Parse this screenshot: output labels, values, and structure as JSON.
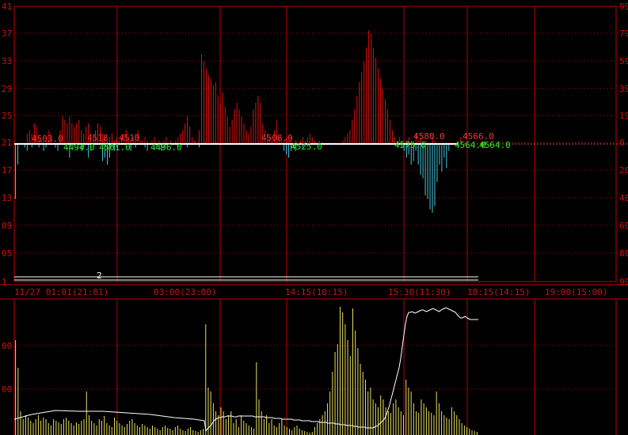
{
  "colors": {
    "background": "#000000",
    "grid": "#c00000",
    "axis_text": "#d01010",
    "time_text": "#c81414",
    "up_bar": "#e01010",
    "down_bar": "#40c8e0",
    "price_line": "#ffffff",
    "dotted_ref": "#ff4040",
    "green_label": "#22ee22",
    "red_label": "#ff3030",
    "volume_bar": "#e8e060",
    "volume_line": "#ffffff"
  },
  "upper_axis": {
    "left_ticks": [
      "41",
      "37",
      "33",
      "29",
      "25",
      "21",
      "17",
      "13",
      "09",
      "05",
      "1"
    ],
    "right_ticks": [
      "99",
      "79",
      "59",
      "39",
      "19",
      "0",
      "20",
      "40",
      "60",
      "80",
      "99"
    ]
  },
  "lower_axis": {
    "left_ticks": [
      "00",
      "00"
    ],
    "right_ticks": [
      "",
      ""
    ]
  },
  "time_axis": [
    "11/27 01:01(21:01)",
    "03:00(23:00)",
    "14:15(10:15)",
    "15:30(11:30)",
    "18:15(14:15)",
    "19:00(15:00)"
  ],
  "marker": "2",
  "price_labels": [
    {
      "text": "4494.0",
      "color": "green"
    },
    {
      "text": "4501.0",
      "color": "green"
    },
    {
      "text": "4496.0",
      "color": "green"
    },
    {
      "text": "4525.0",
      "color": "green"
    },
    {
      "text": "4575.0",
      "color": "green"
    },
    {
      "text": "4564.0",
      "color": "green"
    },
    {
      "text": "4564.0",
      "color": "green"
    },
    {
      "text": "4503.0",
      "color": "red"
    },
    {
      "text": "4510",
      "color": "red"
    },
    {
      "text": "4518",
      "color": "red"
    },
    {
      "text": "4508.0",
      "color": "red"
    },
    {
      "text": "4580.0",
      "color": "red"
    },
    {
      "text": "4566.0",
      "color": "red"
    }
  ],
  "chart_data": [
    {
      "type": "bar",
      "title": "",
      "ylim": [
        1,
        41
      ],
      "baseline": 21,
      "upper_values": [
        0,
        0,
        0,
        0,
        0,
        1.5,
        2,
        1.5,
        3,
        2.5,
        1,
        0.5,
        0,
        1,
        2,
        1.5,
        0,
        0,
        0,
        2,
        4,
        3.5,
        3,
        4,
        3,
        2.5,
        3,
        3.5,
        2,
        1.5,
        2.5,
        3,
        1.5,
        1,
        2,
        3,
        2.5,
        1.5,
        1,
        0.5,
        1,
        1.5,
        0.5,
        1,
        0.5,
        1,
        1.5,
        2,
        1,
        0.5,
        1,
        1.5,
        2,
        0.5,
        0.5,
        1,
        0.5,
        0,
        0.5,
        1,
        0,
        0.5,
        0,
        0.5,
        1,
        0,
        0.5,
        0,
        0.5,
        1,
        1.5,
        2,
        3,
        4,
        2.5,
        1,
        0.5,
        0,
        2,
        13,
        12,
        11,
        10,
        9.5,
        8.5,
        9,
        7,
        6,
        7.5,
        5.5,
        4,
        2.5,
        3.5,
        5,
        6,
        5,
        4,
        3,
        2,
        1.5,
        2.5,
        5,
        6,
        7,
        6,
        3,
        2,
        1.5,
        1,
        0.5,
        2,
        3.5,
        1,
        0.5,
        0.5,
        1,
        0.5,
        1,
        0,
        0.5,
        0,
        0.5,
        1,
        0.5,
        1,
        1.5,
        1,
        0.5,
        0,
        0.5,
        0,
        0,
        0,
        0,
        0,
        0,
        0,
        0,
        0,
        0.5,
        1,
        1.5,
        2,
        3.5,
        5,
        7,
        9,
        10.5,
        12,
        14,
        16.5,
        16,
        14,
        12.5,
        11,
        9.5,
        8,
        6.5,
        5,
        3.5,
        2,
        1,
        0.5,
        1,
        0.5,
        0,
        0.5,
        1,
        0,
        0,
        1.5,
        0.5,
        1,
        0,
        0.5,
        0,
        0,
        1,
        0.5,
        0,
        0,
        0,
        0,
        0,
        0,
        0,
        0,
        0,
        0,
        1,
        0,
        0,
        0,
        0,
        0,
        0,
        0
      ],
      "lower_values": [
        8,
        3,
        0,
        0,
        0.5,
        1,
        0,
        0.5,
        0,
        0,
        0.5,
        0,
        1,
        0.5,
        0,
        0,
        0,
        0.5,
        1,
        0,
        0,
        0,
        0,
        2,
        0,
        0,
        0,
        0,
        1,
        0.5,
        0,
        2,
        1,
        0,
        0,
        0,
        0,
        2.5,
        2,
        3,
        2,
        0.5,
        1,
        0.5,
        0,
        0,
        0,
        0,
        0,
        1,
        0,
        0.5,
        0,
        0,
        0,
        0.5,
        1,
        0,
        0,
        0,
        0.5,
        0,
        1,
        0.5,
        0,
        0,
        0,
        0,
        0,
        0.5,
        0,
        0,
        0,
        0.5,
        0,
        0,
        0,
        0,
        0.5,
        0,
        0,
        0,
        0,
        0,
        0,
        0,
        0,
        0,
        0,
        0,
        0,
        0,
        0,
        0,
        0,
        0,
        0,
        0,
        0,
        0,
        0,
        0,
        0,
        0,
        0,
        0,
        0,
        0,
        0,
        0,
        0,
        0,
        0,
        0,
        1,
        1.5,
        2,
        1,
        0.5,
        1,
        0,
        0,
        0.5,
        0,
        0,
        0,
        0,
        0,
        0,
        0,
        0,
        0,
        0,
        0,
        0,
        0,
        0,
        0,
        0,
        0,
        0,
        0,
        0,
        0,
        0,
        0,
        0,
        0,
        0,
        0,
        0,
        0,
        0,
        0,
        0,
        0,
        0,
        0,
        0,
        0,
        0,
        0,
        0,
        0,
        0.5,
        1,
        2,
        1.5,
        3,
        2.5,
        1,
        3,
        4.5,
        5,
        7.5,
        8,
        9.5,
        10,
        9,
        5.5,
        3,
        4,
        2,
        3.5,
        1,
        0,
        0,
        0,
        0,
        0,
        0,
        0,
        0,
        0,
        0,
        0,
        0,
        0,
        0
      ]
    },
    {
      "type": "bar",
      "title": "",
      "volume_values": [
        120,
        85,
        30,
        20,
        25,
        22,
        18,
        15,
        20,
        25,
        18,
        22,
        20,
        15,
        12,
        20,
        18,
        16,
        14,
        20,
        22,
        18,
        15,
        12,
        16,
        14,
        18,
        20,
        55,
        25,
        18,
        15,
        12,
        20,
        18,
        24,
        15,
        12,
        10,
        22,
        18,
        15,
        12,
        10,
        14,
        18,
        20,
        15,
        12,
        10,
        14,
        12,
        10,
        8,
        12,
        10,
        8,
        6,
        10,
        12,
        9,
        8,
        6,
        10,
        12,
        8,
        6,
        5,
        8,
        10,
        6,
        5,
        4,
        6,
        8,
        140,
        60,
        55,
        40,
        30,
        25,
        35,
        30,
        20,
        25,
        30,
        15,
        20,
        10,
        25,
        18,
        15,
        12,
        10,
        8,
        92,
        45,
        30,
        20,
        25,
        15,
        20,
        12,
        10,
        15,
        20,
        12,
        10,
        8,
        6,
        10,
        12,
        8,
        6,
        5,
        4,
        3,
        4,
        10,
        15,
        20,
        25,
        30,
        40,
        55,
        80,
        105,
        115,
        162,
        155,
        140,
        120,
        100,
        160,
        132,
        110,
        90,
        80,
        70,
        55,
        60,
        45,
        40,
        35,
        50,
        45,
        35,
        30,
        28,
        40,
        45,
        35,
        30,
        25,
        70,
        60,
        55,
        40,
        30,
        28,
        45,
        40,
        35,
        30,
        28,
        25,
        55,
        40,
        30,
        25,
        22,
        20,
        35,
        30,
        25,
        20,
        15,
        12,
        10,
        8,
        6,
        5,
        4
      ],
      "volume_line": [
        0,
        5,
        8,
        10,
        12,
        15,
        18,
        20,
        21,
        22,
        22,
        23,
        23,
        23,
        24,
        24,
        24,
        24,
        23,
        23,
        23,
        24,
        24,
        24,
        24,
        24,
        24,
        24,
        24,
        24,
        24,
        23,
        23,
        23,
        23,
        23,
        23,
        23,
        22,
        22,
        22,
        22,
        22,
        21,
        21,
        21,
        21,
        21,
        20,
        20,
        20,
        20,
        20,
        20,
        20,
        19,
        19,
        19,
        19,
        19,
        18,
        18,
        18,
        18,
        18,
        18,
        17,
        17,
        17,
        17,
        17,
        16,
        16,
        16,
        16,
        16,
        15,
        15,
        15,
        15,
        15,
        14,
        14,
        14,
        13,
        13,
        13,
        13,
        12,
        12,
        12,
        12,
        11,
        11,
        11,
        10,
        10,
        10,
        10,
        10,
        9,
        9,
        9,
        9,
        9,
        10,
        11,
        12,
        14,
        16,
        18,
        20,
        24,
        30,
        36,
        44,
        52,
        60,
        68,
        76,
        84,
        95,
        110,
        125,
        140,
        150,
        155,
        155,
        156,
        155,
        154,
        155,
        156,
        157,
        158,
        158,
        157,
        156,
        157,
        158,
        159,
        160,
        159,
        158,
        157,
        156,
        158,
        159,
        160,
        161,
        160,
        159,
        158,
        157,
        156,
        155,
        152,
        150,
        148,
        148,
        149,
        150,
        148,
        147,
        146,
        146,
        146,
        146,
        146,
        146
      ],
      "left_ticks": [
        "00",
        "00"
      ]
    }
  ]
}
